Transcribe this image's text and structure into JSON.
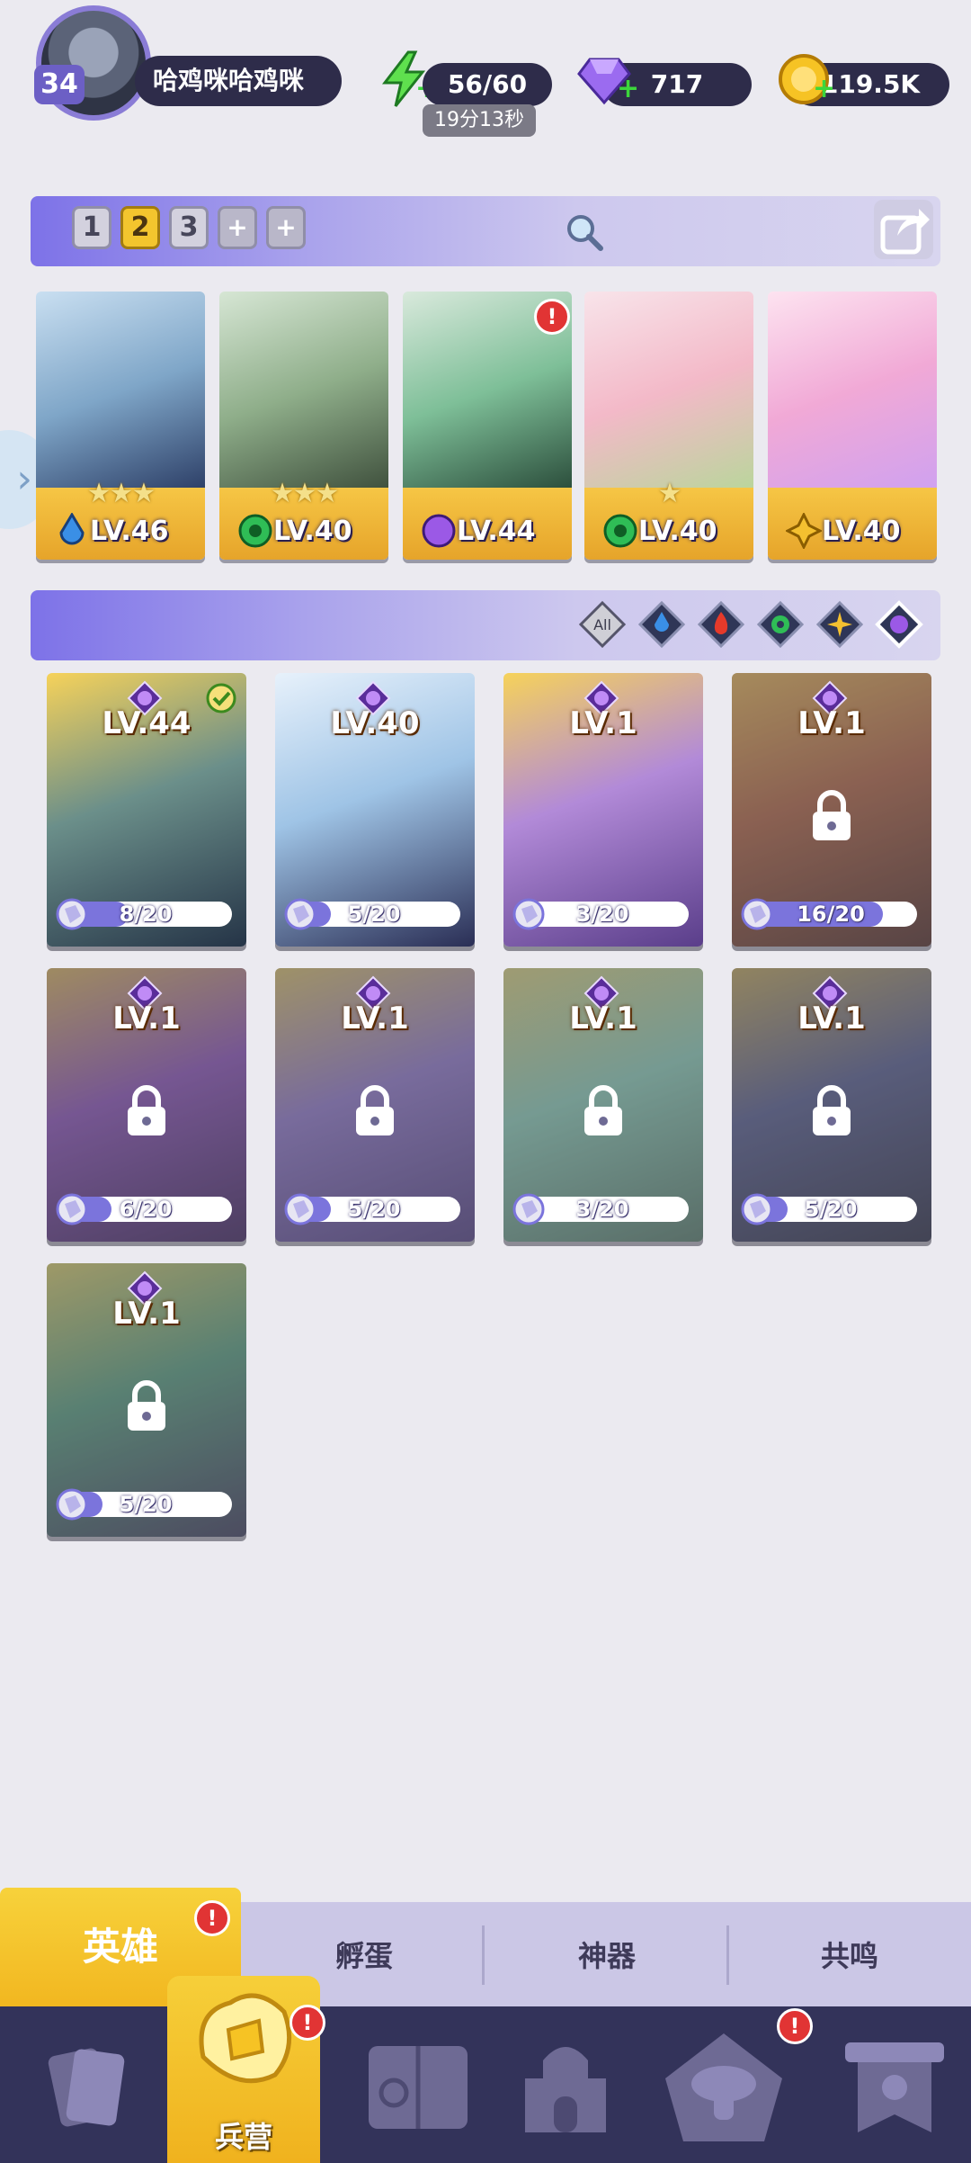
{
  "player": {
    "level": "34",
    "name": "哈鸡咪哈鸡咪"
  },
  "resources": {
    "energy": "56/60",
    "energy_timer": "19分13秒",
    "gems": "717",
    "gold": "119.5K"
  },
  "teams": {
    "tabs": [
      "1",
      "2",
      "3"
    ],
    "active_tab": "2",
    "extra_tabs": [
      "+",
      "+"
    ]
  },
  "team_heroes": [
    {
      "level": "LV.46",
      "stars": "★★★",
      "element": "water"
    },
    {
      "level": "LV.40",
      "stars": "★★★",
      "element": "wind"
    },
    {
      "level": "LV.44",
      "stars": "",
      "element": "dark",
      "badge": "!"
    },
    {
      "level": "LV.40",
      "stars": "★",
      "element": "wind"
    },
    {
      "level": "LV.40",
      "stars": "",
      "element": "light"
    }
  ],
  "filters": {
    "all_label": "All",
    "items": [
      "water",
      "fire",
      "wind",
      "light",
      "dark"
    ],
    "selected": "dark"
  },
  "hero_grid": [
    {
      "level": "LV.44",
      "progress": "8/20",
      "fraction": 0.4,
      "locked": false,
      "checked": true
    },
    {
      "level": "LV.40",
      "progress": "5/20",
      "fraction": 0.25,
      "locked": false,
      "checked": false
    },
    {
      "level": "LV.1",
      "progress": "3/20",
      "fraction": 0.15,
      "locked": false,
      "checked": false
    },
    {
      "level": "LV.1",
      "progress": "16/20",
      "fraction": 0.8,
      "locked": true,
      "checked": false
    },
    {
      "level": "LV.1",
      "progress": "6/20",
      "fraction": 0.3,
      "locked": true,
      "checked": false
    },
    {
      "level": "LV.1",
      "progress": "5/20",
      "fraction": 0.25,
      "locked": true,
      "checked": false
    },
    {
      "level": "LV.1",
      "progress": "3/20",
      "fraction": 0.15,
      "locked": true,
      "checked": false
    },
    {
      "level": "LV.1",
      "progress": "5/20",
      "fraction": 0.25,
      "locked": true,
      "checked": false
    },
    {
      "level": "LV.1",
      "progress": "5/20",
      "fraction": 0.25,
      "locked": true,
      "checked": false
    }
  ],
  "subtabs": {
    "hero": "英雄",
    "hatch": "孵蛋",
    "artifact": "神器",
    "resonance": "共鸣",
    "hero_badge": "!"
  },
  "bottom_nav": {
    "barracks_label": "兵营",
    "barracks_badge": "!",
    "guild_badge": "!"
  },
  "colors": {
    "accent_yellow": "#f3c52e",
    "accent_purple": "#7d72e8",
    "nav_dark": "#33335a",
    "badge_red": "#e13434"
  }
}
